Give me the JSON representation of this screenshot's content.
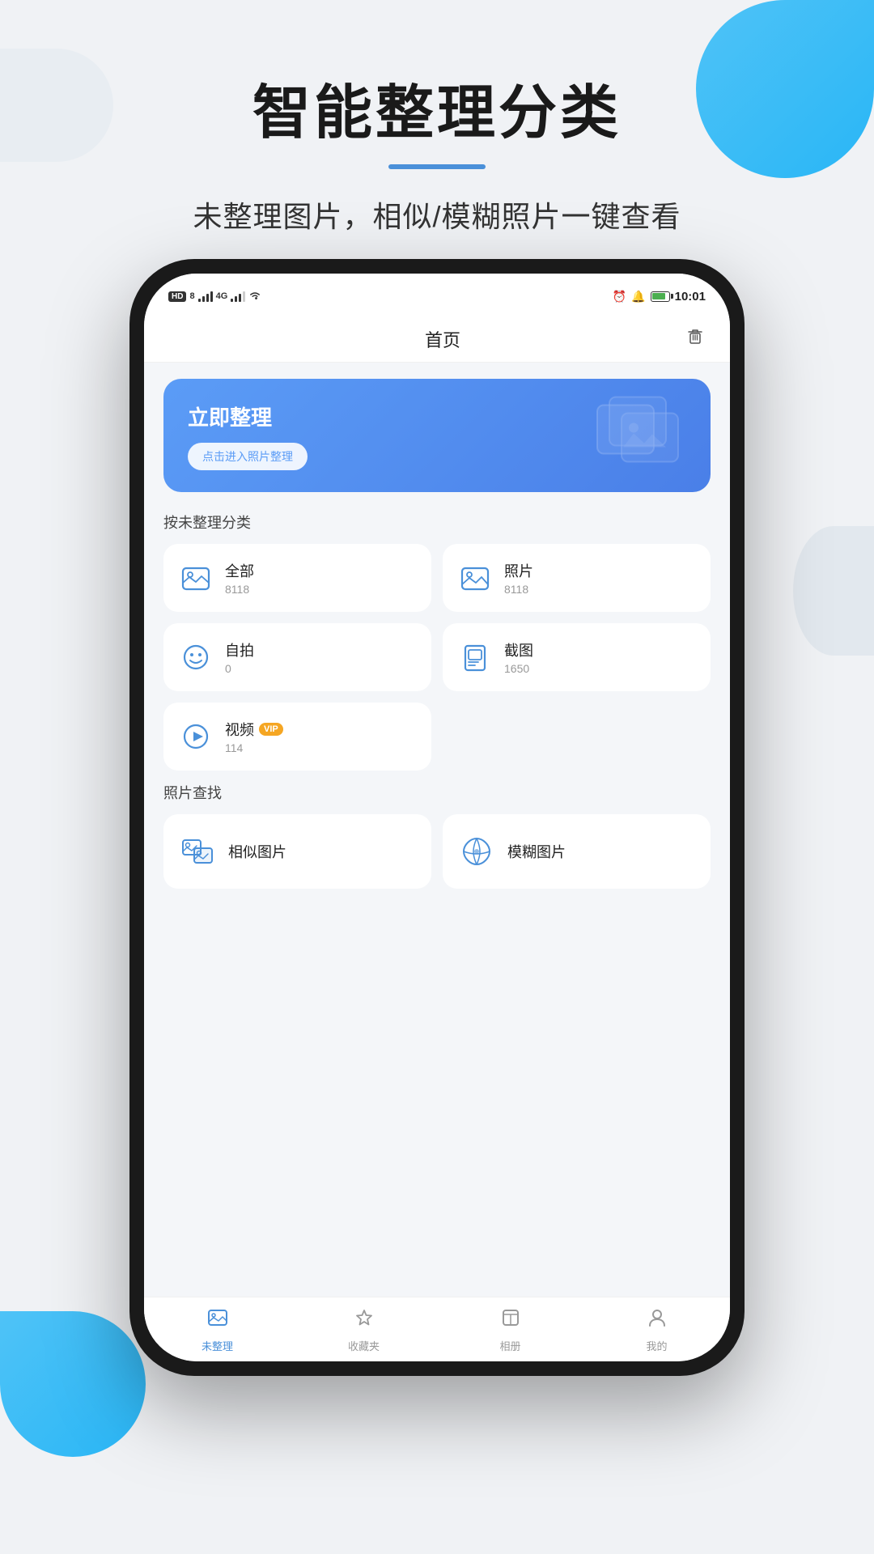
{
  "page": {
    "background_color": "#f0f2f5",
    "title": "智能整理分类",
    "subtitle": "未整理图片，相似/模糊照片一键查看",
    "accent_color": "#4a90d9"
  },
  "status_bar": {
    "left_items": [
      "HD",
      "4G",
      "4G",
      "WiFi"
    ],
    "right_items": [
      "alarm",
      "bell",
      "89",
      "10:01"
    ]
  },
  "app": {
    "nav_title": "首页",
    "nav_trash_label": "trash",
    "banner": {
      "title": "立即整理",
      "button_label": "点击进入照片整理"
    },
    "section1_title": "按未整理分类",
    "categories": [
      {
        "label": "全部",
        "count": "8118",
        "vip": false
      },
      {
        "label": "照片",
        "count": "8118",
        "vip": false
      },
      {
        "label": "自拍",
        "count": "0",
        "vip": false
      },
      {
        "label": "截图",
        "count": "1650",
        "vip": false
      },
      {
        "label": "视频",
        "count": "114",
        "vip": true
      }
    ],
    "section2_title": "照片查找",
    "photo_find": [
      {
        "label": "相似图片"
      },
      {
        "label": "模糊图片"
      }
    ],
    "bottom_nav": [
      {
        "label": "未整理",
        "active": true
      },
      {
        "label": "收藏夹",
        "active": false
      },
      {
        "label": "相册",
        "active": false
      },
      {
        "label": "我的",
        "active": false
      }
    ]
  }
}
